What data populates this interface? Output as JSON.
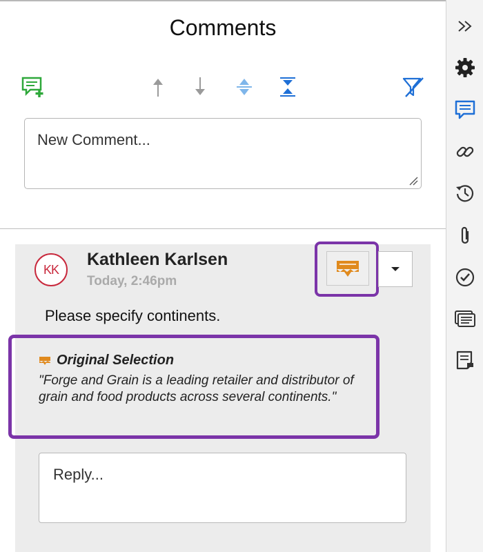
{
  "panel": {
    "title": "Comments",
    "new_comment_placeholder": "New Comment..."
  },
  "toolbar": {
    "icons": [
      "add-comment-icon",
      "arrow-up-icon",
      "arrow-down-icon",
      "expand-all-icon",
      "collapse-all-icon",
      "filter-icon"
    ]
  },
  "comment": {
    "avatar_initials": "KK",
    "author": "Kathleen Karlsen",
    "timestamp": "Today, 2:46pm",
    "body": "Please specify continents.",
    "original_selection": {
      "title": "Original Selection",
      "text": "\"Forge and Grain is a leading retailer and distributor of grain and food products across several continents.\""
    },
    "reply_placeholder": "Reply..."
  },
  "right_bar": {
    "icons": [
      "collapse-panel-icon",
      "settings-icon",
      "comments-icon",
      "link-icon",
      "history-icon",
      "attachment-icon",
      "tasks-icon",
      "outline-icon",
      "notes-icon"
    ]
  },
  "colors": {
    "accent_blue": "#1e6fd6",
    "highlight_purple": "#7b34a8",
    "anchor_orange": "#e08a1e",
    "avatar_red": "#c8283c",
    "add_green": "#2ea83a"
  }
}
